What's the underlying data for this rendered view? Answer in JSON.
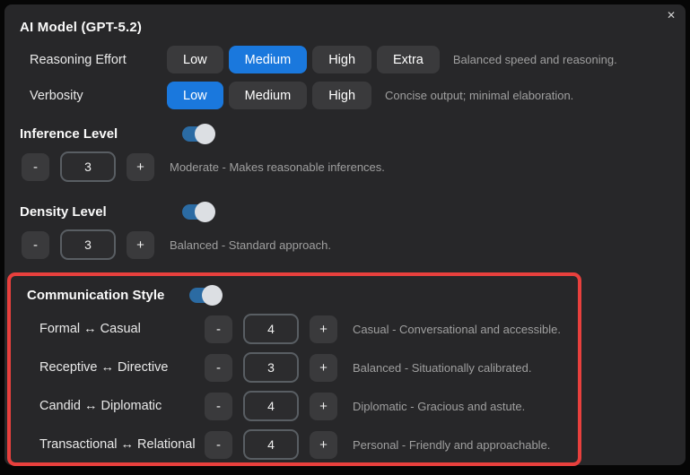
{
  "controls": {
    "close": "✕",
    "minus": "-",
    "plus": "+"
  },
  "title": "AI Model (GPT-5.2)",
  "colors": {
    "accent_blue": "#1a78dd",
    "toggle_blue": "#2b6ba3",
    "highlight_red": "#e8403d"
  },
  "segmented_rows": [
    {
      "label": "Reasoning Effort",
      "options": [
        "Low",
        "Medium",
        "High",
        "Extra"
      ],
      "selected": "Medium",
      "description": "Balanced speed and reasoning."
    },
    {
      "label": "Verbosity",
      "options": [
        "Low",
        "Medium",
        "High"
      ],
      "selected": "Low",
      "description": "Concise output; minimal elaboration."
    }
  ],
  "sections": [
    {
      "label": "Inference Level",
      "toggle_on": true,
      "stepper": {
        "value": "3",
        "description": "Moderate - Makes reasonable inferences."
      }
    },
    {
      "label": "Density Level",
      "toggle_on": true,
      "stepper": {
        "value": "3",
        "description": "Balanced - Standard approach."
      }
    }
  ],
  "communication": {
    "label": "Communication Style",
    "toggle_on": true,
    "rows": [
      {
        "label": "Formal ↔ Casual",
        "value": "4",
        "description": "Casual - Conversational and accessible."
      },
      {
        "label": "Receptive ↔ Directive",
        "value": "3",
        "description": "Balanced - Situationally calibrated."
      },
      {
        "label": "Candid ↔ Diplomatic",
        "value": "4",
        "description": "Diplomatic - Gracious and astute."
      },
      {
        "label": "Transactional ↔ Relational",
        "value": "4",
        "description": "Personal - Friendly and approachable."
      }
    ]
  }
}
